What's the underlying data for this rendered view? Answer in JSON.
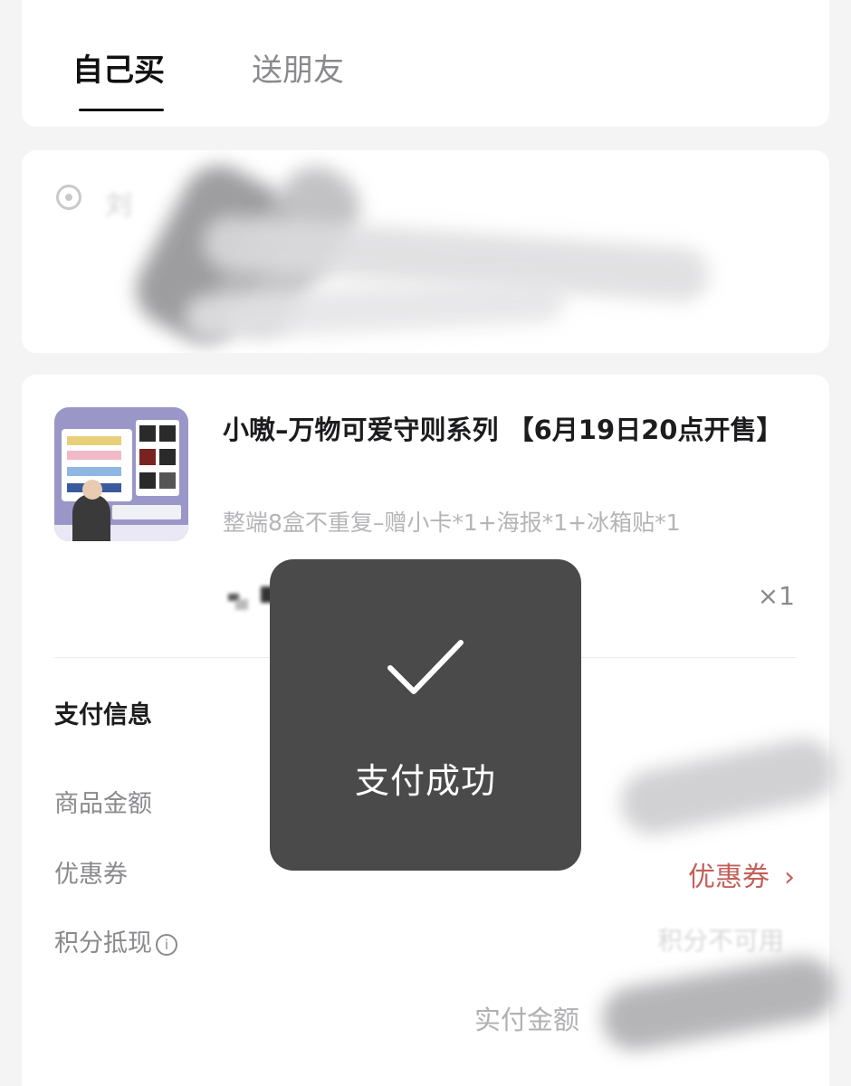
{
  "tabs": {
    "self_buy": "自己买",
    "gift_friend": "送朋友"
  },
  "address": {
    "text": "刘"
  },
  "product": {
    "title": "小嗷–万物可爱守则系列 【6月19日20点开售】",
    "spec": "整端8盒不重复–赠小卡*1+海报*1+冰箱贴*1",
    "quantity": "×1"
  },
  "payment": {
    "section_title": "支付信息",
    "goods_amount_label": "商品金额",
    "coupon_label": "优惠券",
    "coupon_value": "优惠券",
    "points_label": "积分抵现",
    "points_value": "积分不可用",
    "paid_amount_label": "实付金额"
  },
  "toast": {
    "message": "支付成功"
  },
  "colors": {
    "coupon_accent": "#c2605a",
    "toast_bg": "#4a4a4a"
  }
}
